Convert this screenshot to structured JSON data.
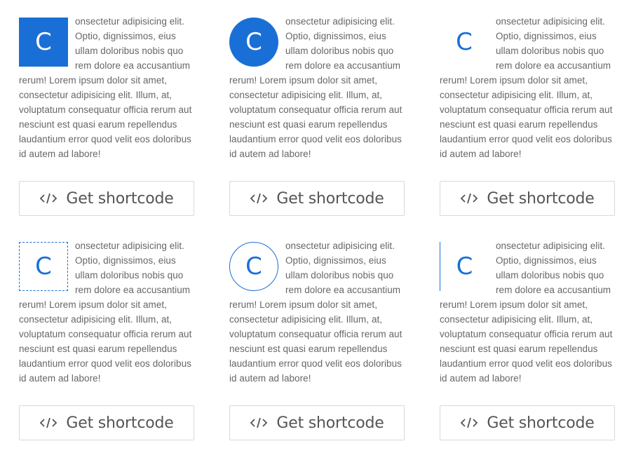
{
  "accent_color": "#1a6fd6",
  "button_icon": "code-icon",
  "cards": [
    {
      "style": "filled-square",
      "letter": "C",
      "text": "onsectetur adipisicing elit. Optio, dignissimos, eius ullam doloribus nobis quo rem dolore ea accusantium rerum! Lorem ipsum dolor sit amet, consectetur adipisicing elit. Illum, at, voluptatum consequatur officia rerum aut nesciunt est quasi earum repellendus laudantium error quod velit eos doloribus id autem ad labore!",
      "button_label": "Get shortcode"
    },
    {
      "style": "filled-circle",
      "letter": "C",
      "text": "onsectetur adipisicing elit. Optio, dignissimos, eius ullam doloribus nobis quo rem dolore ea accusantium rerum! Lorem ipsum dolor sit amet, consectetur adipisicing elit. Illum, at, voluptatum consequatur officia rerum aut nesciunt est quasi earum repellendus laudantium error quod velit eos doloribus id autem ad labore!",
      "button_label": "Get shortcode"
    },
    {
      "style": "plain",
      "letter": "C",
      "text": "onsectetur adipisicing elit. Optio, dignissimos, eius ullam doloribus nobis quo rem dolore ea accusantium rerum! Lorem ipsum dolor sit amet, consectetur adipisicing elit. Illum, at, voluptatum consequatur officia rerum aut nesciunt est quasi earum repellendus laudantium error quod velit eos doloribus id autem ad labore!",
      "button_label": "Get shortcode"
    },
    {
      "style": "dashed-square",
      "letter": "C",
      "text": "onsectetur adipisicing elit. Optio, dignissimos, eius ullam doloribus nobis quo rem dolore ea accusantium rerum! Lorem ipsum dolor sit amet, consectetur adipisicing elit. Illum, at, voluptatum consequatur officia rerum aut nesciunt est quasi earum repellendus laudantium error quod velit eos doloribus id autem ad labore!",
      "button_label": "Get shortcode"
    },
    {
      "style": "outline-circle",
      "letter": "C",
      "text": "onsectetur adipisicing elit. Optio, dignissimos, eius ullam doloribus nobis quo rem dolore ea accusantium rerum! Lorem ipsum dolor sit amet, consectetur adipisicing elit. Illum, at, voluptatum consequatur officia rerum aut nesciunt est quasi earum repellendus laudantium error quod velit eos doloribus id autem ad labore!",
      "button_label": "Get shortcode"
    },
    {
      "style": "left-line",
      "letter": "C",
      "text": "onsectetur adipisicing elit. Optio, dignissimos, eius ullam doloribus nobis quo rem dolore ea accusantium rerum! Lorem ipsum dolor sit amet, consectetur adipisicing elit. Illum, at, voluptatum consequatur officia rerum aut nesciunt est quasi earum repellendus laudantium error quod velit eos doloribus id autem ad labore!",
      "button_label": "Get shortcode"
    }
  ]
}
